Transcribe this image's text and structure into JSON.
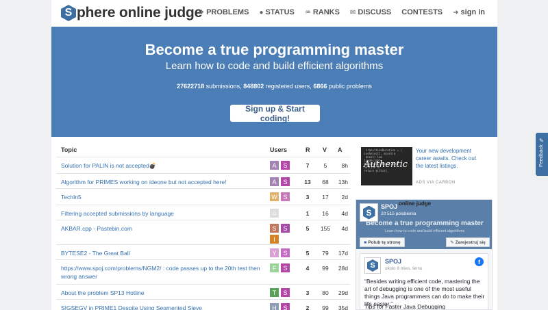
{
  "header": {
    "logo_letter": "S",
    "logo_text": "phere online judge",
    "nav": [
      {
        "label": "PROBLEMS",
        "icon": "puzzle-icon",
        "glyph": "❖"
      },
      {
        "label": "STATUS",
        "icon": "circle-icon",
        "glyph": "●"
      },
      {
        "label": "RANKS",
        "icon": "trophy-icon",
        "glyph": "♒"
      },
      {
        "label": "DISCUSS",
        "icon": "chat-icon",
        "glyph": "✉"
      },
      {
        "label": "CONTESTS",
        "icon": "",
        "glyph": ""
      },
      {
        "label": "sign in",
        "icon": "sign-in-icon",
        "glyph": "➜"
      }
    ]
  },
  "hero": {
    "title": "Become a true programming master",
    "subtitle": "Learn how to code and build efficient algorithms",
    "submissions_count": "27622718",
    "submissions_label": "submissions,",
    "users_count": "848802",
    "users_label": "registered users,",
    "problems_count": "6866",
    "problems_label": "public problems",
    "cta_label": "Sign up & Start coding!"
  },
  "forum": {
    "headers": {
      "topic": "Topic",
      "users": "Users",
      "r": "R",
      "v": "V",
      "a": "A"
    },
    "rows": [
      {
        "topic": "Solution for PALIN is not accepted💣",
        "avatars": [
          {
            "l": "A",
            "c": "#a383b1"
          },
          {
            "l": "S",
            "c": "#b546a8"
          }
        ],
        "r": "7",
        "v": "5",
        "a": "8h"
      },
      {
        "topic": "Algorithm for PRIMES working on ideone but not accepted here!",
        "avatars": [
          {
            "l": "A",
            "c": "#a383b1"
          },
          {
            "l": "S",
            "c": "#b546a8"
          }
        ],
        "r": "13",
        "v": "68",
        "a": "13h"
      },
      {
        "topic": "TechIn5",
        "avatars": [
          {
            "l": "W",
            "c": "#e0b26b"
          },
          {
            "l": "S",
            "c": "#c77ab7"
          }
        ],
        "r": "3",
        "v": "17",
        "a": "2d"
      },
      {
        "topic": "Filtering accepted submissions by language",
        "avatars": [
          {
            "l": "",
            "c": "user"
          }
        ],
        "r": "1",
        "v": "16",
        "a": "4d"
      },
      {
        "topic": "AKBAR.cpp - Pastebin.com",
        "avatars": [
          {
            "l": "S",
            "c": "#c2765f"
          },
          {
            "l": "S",
            "c": "#a64aa8"
          },
          {
            "l": "I",
            "c": "#d28427"
          }
        ],
        "r": "5",
        "v": "155",
        "a": "4d"
      },
      {
        "topic": "BYTESE2 - The Great Ball",
        "avatars": [
          {
            "l": "Y",
            "c": "#d9a0d6"
          },
          {
            "l": "S",
            "c": "#c46cc4"
          }
        ],
        "r": "5",
        "v": "79",
        "a": "17d"
      },
      {
        "topic": "https://www.spoj.com/problems/NGM2/ : code passes up to the 20th test then wrong answer",
        "avatars": [
          {
            "l": "F",
            "c": "#9bd39b"
          },
          {
            "l": "S",
            "c": "#b546a8"
          }
        ],
        "r": "4",
        "v": "99",
        "a": "28d"
      },
      {
        "topic": "About the problem SP13 Hotline",
        "avatars": [
          {
            "l": "T",
            "c": "#5aa05a"
          },
          {
            "l": "S",
            "c": "#b546a8"
          }
        ],
        "r": "3",
        "v": "80",
        "a": "29d"
      },
      {
        "topic": "SIGSEGV in PRIME1 Despite Using Segmented Sieve",
        "avatars": [
          {
            "l": "H",
            "c": "#8e9bb6"
          },
          {
            "l": "S",
            "c": "#b546a8"
          }
        ],
        "r": "2",
        "v": "99",
        "a": "35d"
      }
    ]
  },
  "ad": {
    "image_word": "Authentic",
    "text": "Your new development career awaits. Check out the latest listings.",
    "by": "ADS VIA CARBON"
  },
  "facebook": {
    "cover_title": "online judge",
    "cover_master": "Become a true programming master",
    "cover_sub": "Learn how to code and build efficient algorithms",
    "page_name": "SPOJ",
    "likes": "20 515 polubienia",
    "like_button": "Polub tę stronę",
    "signup_button": "Zarejestruj się",
    "post_name": "SPOJ",
    "post_time": "około 8 mies. temu",
    "post_text": "“Besides writing efficient code, mastering the art of debugging is one of the most useful things Java programmers can do to make their life easier.”",
    "post_text2": "Tips for Faster Java Debugging"
  },
  "feedback": {
    "label": "Feedback"
  },
  "colors": {
    "brand": "#3d6fa3",
    "hero": "#4b7db7",
    "link": "#3370b0"
  }
}
